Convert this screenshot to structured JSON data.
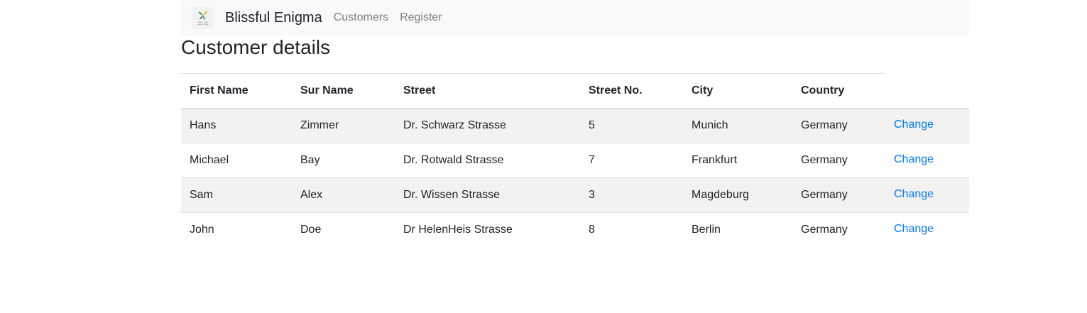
{
  "navbar": {
    "brand": "Blissful Enigma",
    "logo_icon": "blissful-enigma-logo",
    "links": [
      {
        "label": "Customers"
      },
      {
        "label": "Register"
      }
    ]
  },
  "page": {
    "title": "Customer details"
  },
  "table": {
    "headers": [
      "First Name",
      "Sur Name",
      "Street",
      "Street No.",
      "City",
      "Country",
      ""
    ],
    "rows": [
      {
        "first": "Hans",
        "last": "Zimmer",
        "street": "Dr. Schwarz Strasse",
        "no": "5",
        "city": "Munich",
        "country": "Germany",
        "action": "Change"
      },
      {
        "first": "Michael",
        "last": "Bay",
        "street": "Dr. Rotwald Strasse",
        "no": "7",
        "city": "Frankfurt",
        "country": "Germany",
        "action": "Change"
      },
      {
        "first": "Sam",
        "last": "Alex",
        "street": "Dr. Wissen Strasse",
        "no": "3",
        "city": "Magdeburg",
        "country": "Germany",
        "action": "Change"
      },
      {
        "first": "John",
        "last": "Doe",
        "street": "Dr HelenHeis Strasse",
        "no": "8",
        "city": "Berlin",
        "country": "Germany",
        "action": "Change"
      }
    ]
  },
  "colors": {
    "link": "#007bff",
    "navbar_bg": "#f8f9fa",
    "stripe": "#f2f2f2",
    "nav_link": "#7f7f7f"
  }
}
